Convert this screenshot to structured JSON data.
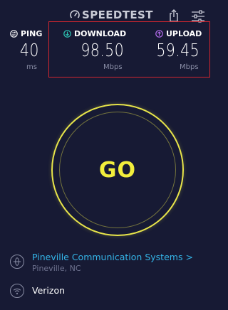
{
  "header": {
    "app_title": "SPEEDTEST"
  },
  "ping": {
    "label": "PING",
    "value": "40",
    "unit": "ms"
  },
  "download": {
    "label": "DOWNLOAD",
    "value": "98.50",
    "unit": "Mbps"
  },
  "upload": {
    "label": "UPLOAD",
    "value": "59.45",
    "unit": "Mbps"
  },
  "go_button": {
    "label": "GO"
  },
  "server": {
    "name": "Pineville Communication Systems",
    "chevron": ">",
    "location": "Pineville, NC"
  },
  "isp": {
    "name": "Verizon"
  },
  "colors": {
    "background": "#171a34",
    "go_accent": "#f2ee3c",
    "download_icon": "#2ec5b5",
    "upload_icon": "#b66ef0",
    "server_link": "#34b5e8",
    "highlight_box": "#d2262f"
  }
}
